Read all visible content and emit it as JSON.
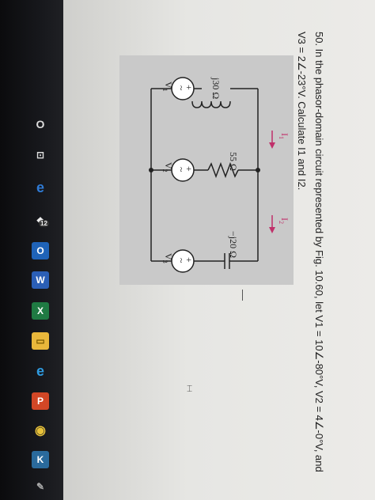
{
  "question": {
    "text": "50. In the phasor-domain circuit represented by Fig. 10.60, let V1 = 10∠-80°V, V2 = 4∠-0°V, and V3 = 2∠-23°V. Calculate I1 and I2."
  },
  "figure": {
    "inductor_label": "j30 Ω",
    "resistor_label": "55 Ω",
    "capacitor_label": "−j20 Ω",
    "current1": "I",
    "current1_sub": "1",
    "current2": "I",
    "current2_sub": "2",
    "source1": "V",
    "source1_sub": "1",
    "source2": "V",
    "source2_sub": "2",
    "source3": "V",
    "source3_sub": "3",
    "plus": "+",
    "tilde": "~"
  },
  "taskbar": {
    "items": [
      {
        "name": "cortana-icon",
        "glyph": "O"
      },
      {
        "name": "task-view-icon",
        "glyph": "⊡"
      },
      {
        "name": "edge-icon",
        "glyph": "e"
      },
      {
        "name": "dropbox-icon",
        "glyph": "❖",
        "badge": "12"
      },
      {
        "name": "outlook-icon",
        "glyph": "O"
      },
      {
        "name": "word-icon",
        "glyph": "W"
      },
      {
        "name": "excel-icon",
        "glyph": "X"
      },
      {
        "name": "file-explorer-icon",
        "glyph": "▭"
      },
      {
        "name": "internet-explorer-icon",
        "glyph": "e"
      },
      {
        "name": "powerpoint-icon",
        "glyph": "P"
      },
      {
        "name": "chrome-icon",
        "glyph": "◉"
      },
      {
        "name": "app-icon",
        "glyph": "K"
      },
      {
        "name": "pin-icon",
        "glyph": "✎"
      }
    ]
  },
  "colors": {
    "arrow": "#c0306a",
    "edge": "#2f7bd6",
    "outlook": "#1f63b8",
    "word": "#2b5fb6",
    "excel": "#1f7a43",
    "explorer": "#e9b73b",
    "powerpoint": "#d24726"
  }
}
